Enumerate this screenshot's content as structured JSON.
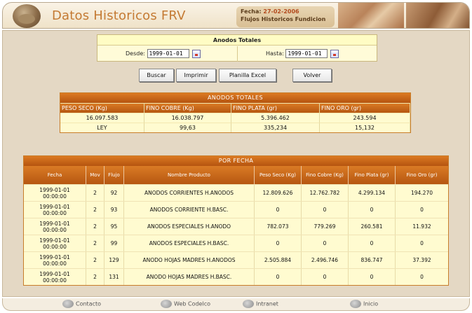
{
  "header": {
    "title": "Datos Historicos FRV",
    "fecha_label": "Fecha:",
    "fecha_value": "27-02-2006",
    "subtitle": "Flujos Historicos Fundicion"
  },
  "search": {
    "title": "Anodos Totales",
    "desde_label": "Desde:",
    "desde_value": "1999-01-01",
    "hasta_label": "Hasta:",
    "hasta_value": "1999-01-01",
    "calendar_icon": "calendar-icon"
  },
  "buttons": {
    "buscar": "Buscar",
    "imprimir": "Imprimir",
    "excel": "Planilla Excel",
    "volver": "Volver"
  },
  "totales": {
    "title": "ANODOS TOTALES",
    "headers": [
      "PESO SECO (Kg)",
      "FINO COBRE (Kg)",
      "FINO PLATA (gr)",
      "FINO ORO (gr)"
    ],
    "row1": [
      "16.097.583",
      "16.038.797",
      "5.396.462",
      "243.594"
    ],
    "row2": [
      "LEY",
      "99,63",
      "335,234",
      "15,132"
    ]
  },
  "por_fecha": {
    "title": "POR FECHA",
    "headers": [
      "Fecha",
      "Mov",
      "Flujo",
      "Nombre Producto",
      "Peso Seco (Kg)",
      "Fino Cobre (Kg)",
      "Fino Plata (gr)",
      "Fino Oro (gr)"
    ],
    "rows": [
      {
        "fecha": "1999-01-01",
        "hora": "00:00:00",
        "mov": "2",
        "flujo": "92",
        "nombre": "ANODOS CORRIENTES H.ANODOS",
        "peso": "12.809.626",
        "cobre": "12.762.782",
        "plata": "4.299.134",
        "oro": "194.270"
      },
      {
        "fecha": "1999-01-01",
        "hora": "00:00:00",
        "mov": "2",
        "flujo": "93",
        "nombre": "ANODOS CORRIENTE H.BASC.",
        "peso": "0",
        "cobre": "0",
        "plata": "0",
        "oro": "0"
      },
      {
        "fecha": "1999-01-01",
        "hora": "00:00:00",
        "mov": "2",
        "flujo": "95",
        "nombre": "ANODOS ESPECIALES H.ANODO",
        "peso": "782.073",
        "cobre": "779.269",
        "plata": "260.581",
        "oro": "11.932"
      },
      {
        "fecha": "1999-01-01",
        "hora": "00:00:00",
        "mov": "2",
        "flujo": "99",
        "nombre": "ANODOS ESPECIALES H.BASC.",
        "peso": "0",
        "cobre": "0",
        "plata": "0",
        "oro": "0"
      },
      {
        "fecha": "1999-01-01",
        "hora": "00:00:00",
        "mov": "2",
        "flujo": "129",
        "nombre": "ANODO HOJAS MADRES H.ANODOS",
        "peso": "2.505.884",
        "cobre": "2.496.746",
        "plata": "836.747",
        "oro": "37.392"
      },
      {
        "fecha": "1999-01-01",
        "hora": "00:00:00",
        "mov": "2",
        "flujo": "131",
        "nombre": "ANODO HOJAS MADRES H.BASC.",
        "peso": "0",
        "cobre": "0",
        "plata": "0",
        "oro": "0"
      }
    ]
  },
  "footer": {
    "contacto": "Contacto",
    "web": "Web Codelco",
    "intranet": "Intranet",
    "inicio": "Inicio"
  },
  "colors": {
    "accent": "#c47a33",
    "table_header": "#c8661a",
    "cell_bg": "#fffbd0",
    "page_bg": "#e4d8c4"
  }
}
